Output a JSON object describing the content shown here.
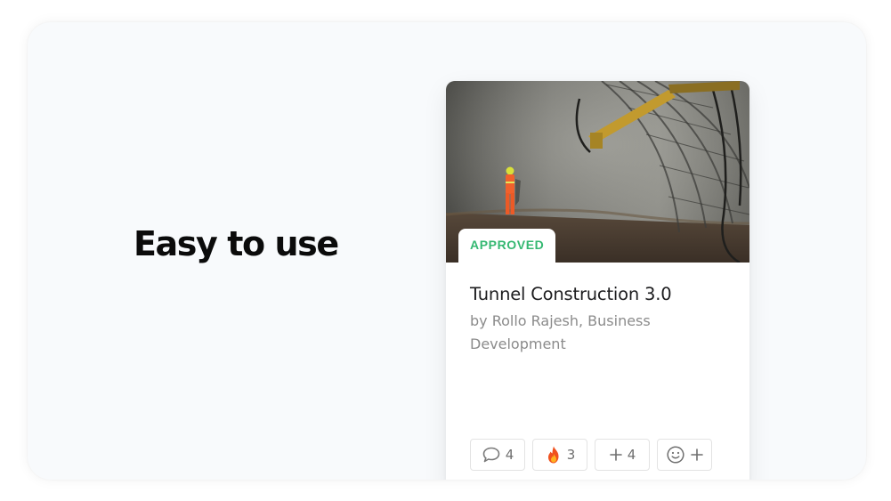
{
  "headline": "Easy to use",
  "card": {
    "status": "APPROVED",
    "status_color": "#35b872",
    "title": "Tunnel Construction 3.0",
    "byline": "by Rollo Rajesh, Business Development",
    "image_icon": "tunnel-construction-photo"
  },
  "reactions": [
    {
      "icon": "comment-icon",
      "count": "4"
    },
    {
      "icon": "fire-icon",
      "count": "3"
    },
    {
      "icon": "plus-icon",
      "count": "4"
    },
    {
      "icon": "add-reaction-icon",
      "count": ""
    }
  ]
}
